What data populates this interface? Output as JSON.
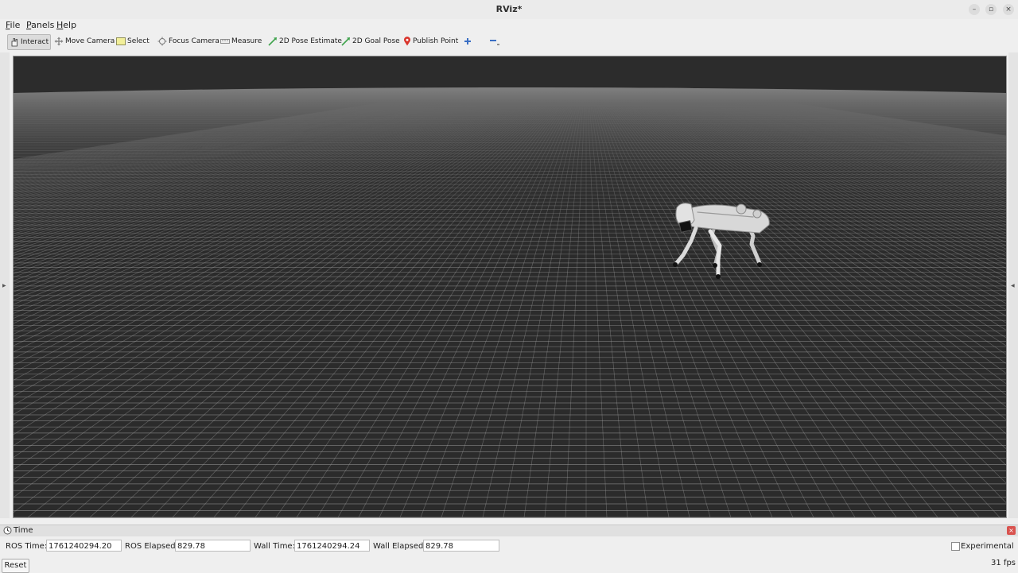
{
  "window": {
    "title": "RViz*"
  },
  "menu": [
    {
      "label": "File",
      "mnemonic": "F",
      "rest": "ile"
    },
    {
      "label": "Panels",
      "mnemonic": "P",
      "rest": "anels"
    },
    {
      "label": "Help",
      "mnemonic": "H",
      "rest": "elp"
    }
  ],
  "toolbar": {
    "interact": "Interact",
    "move_camera": "Move Camera",
    "select": "Select",
    "focus_camera": "Focus Camera",
    "measure": "Measure",
    "pose_estimate": "2D Pose Estimate",
    "goal_pose": "2D Goal Pose",
    "publish_point": "Publish Point"
  },
  "time_panel": {
    "title": "Time",
    "ros_time_label": "ROS Time:",
    "ros_time": "1761240294.20",
    "ros_elapsed_label": "ROS Elapsed:",
    "ros_elapsed": "829.78",
    "wall_time_label": "Wall Time:",
    "wall_time": "1761240294.24",
    "wall_elapsed_label": "Wall Elapsed:",
    "wall_elapsed": "829.78",
    "experimental_label": "Experimental",
    "experimental_checked": false
  },
  "status": {
    "reset_label": "Reset",
    "fps": "31 fps"
  },
  "colors": {
    "viewport_bg": "#2b2b2b",
    "grid": "#a0a0a0",
    "robot": "#d4d4d4",
    "pin": "#d9342b",
    "pose_arrow": "#3fa34d"
  }
}
